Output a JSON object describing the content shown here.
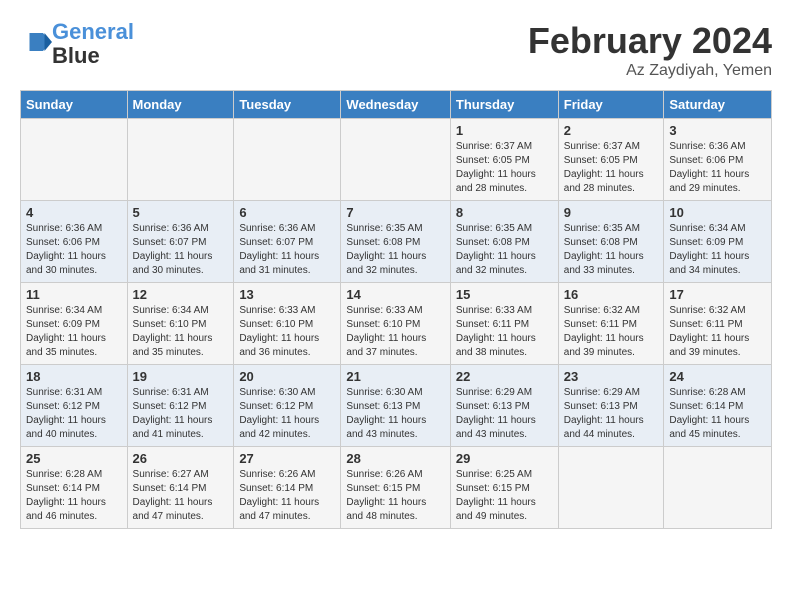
{
  "logo": {
    "line1": "General",
    "line2": "Blue"
  },
  "title": "February 2024",
  "location": "Az Zaydiyah, Yemen",
  "days_of_week": [
    "Sunday",
    "Monday",
    "Tuesday",
    "Wednesday",
    "Thursday",
    "Friday",
    "Saturday"
  ],
  "weeks": [
    [
      {
        "day": "",
        "info": ""
      },
      {
        "day": "",
        "info": ""
      },
      {
        "day": "",
        "info": ""
      },
      {
        "day": "",
        "info": ""
      },
      {
        "day": "1",
        "info": "Sunrise: 6:37 AM\nSunset: 6:05 PM\nDaylight: 11 hours\nand 28 minutes."
      },
      {
        "day": "2",
        "info": "Sunrise: 6:37 AM\nSunset: 6:05 PM\nDaylight: 11 hours\nand 28 minutes."
      },
      {
        "day": "3",
        "info": "Sunrise: 6:36 AM\nSunset: 6:06 PM\nDaylight: 11 hours\nand 29 minutes."
      }
    ],
    [
      {
        "day": "4",
        "info": "Sunrise: 6:36 AM\nSunset: 6:06 PM\nDaylight: 11 hours\nand 30 minutes."
      },
      {
        "day": "5",
        "info": "Sunrise: 6:36 AM\nSunset: 6:07 PM\nDaylight: 11 hours\nand 30 minutes."
      },
      {
        "day": "6",
        "info": "Sunrise: 6:36 AM\nSunset: 6:07 PM\nDaylight: 11 hours\nand 31 minutes."
      },
      {
        "day": "7",
        "info": "Sunrise: 6:35 AM\nSunset: 6:08 PM\nDaylight: 11 hours\nand 32 minutes."
      },
      {
        "day": "8",
        "info": "Sunrise: 6:35 AM\nSunset: 6:08 PM\nDaylight: 11 hours\nand 32 minutes."
      },
      {
        "day": "9",
        "info": "Sunrise: 6:35 AM\nSunset: 6:08 PM\nDaylight: 11 hours\nand 33 minutes."
      },
      {
        "day": "10",
        "info": "Sunrise: 6:34 AM\nSunset: 6:09 PM\nDaylight: 11 hours\nand 34 minutes."
      }
    ],
    [
      {
        "day": "11",
        "info": "Sunrise: 6:34 AM\nSunset: 6:09 PM\nDaylight: 11 hours\nand 35 minutes."
      },
      {
        "day": "12",
        "info": "Sunrise: 6:34 AM\nSunset: 6:10 PM\nDaylight: 11 hours\nand 35 minutes."
      },
      {
        "day": "13",
        "info": "Sunrise: 6:33 AM\nSunset: 6:10 PM\nDaylight: 11 hours\nand 36 minutes."
      },
      {
        "day": "14",
        "info": "Sunrise: 6:33 AM\nSunset: 6:10 PM\nDaylight: 11 hours\nand 37 minutes."
      },
      {
        "day": "15",
        "info": "Sunrise: 6:33 AM\nSunset: 6:11 PM\nDaylight: 11 hours\nand 38 minutes."
      },
      {
        "day": "16",
        "info": "Sunrise: 6:32 AM\nSunset: 6:11 PM\nDaylight: 11 hours\nand 39 minutes."
      },
      {
        "day": "17",
        "info": "Sunrise: 6:32 AM\nSunset: 6:11 PM\nDaylight: 11 hours\nand 39 minutes."
      }
    ],
    [
      {
        "day": "18",
        "info": "Sunrise: 6:31 AM\nSunset: 6:12 PM\nDaylight: 11 hours\nand 40 minutes."
      },
      {
        "day": "19",
        "info": "Sunrise: 6:31 AM\nSunset: 6:12 PM\nDaylight: 11 hours\nand 41 minutes."
      },
      {
        "day": "20",
        "info": "Sunrise: 6:30 AM\nSunset: 6:12 PM\nDaylight: 11 hours\nand 42 minutes."
      },
      {
        "day": "21",
        "info": "Sunrise: 6:30 AM\nSunset: 6:13 PM\nDaylight: 11 hours\nand 43 minutes."
      },
      {
        "day": "22",
        "info": "Sunrise: 6:29 AM\nSunset: 6:13 PM\nDaylight: 11 hours\nand 43 minutes."
      },
      {
        "day": "23",
        "info": "Sunrise: 6:29 AM\nSunset: 6:13 PM\nDaylight: 11 hours\nand 44 minutes."
      },
      {
        "day": "24",
        "info": "Sunrise: 6:28 AM\nSunset: 6:14 PM\nDaylight: 11 hours\nand 45 minutes."
      }
    ],
    [
      {
        "day": "25",
        "info": "Sunrise: 6:28 AM\nSunset: 6:14 PM\nDaylight: 11 hours\nand 46 minutes."
      },
      {
        "day": "26",
        "info": "Sunrise: 6:27 AM\nSunset: 6:14 PM\nDaylight: 11 hours\nand 47 minutes."
      },
      {
        "day": "27",
        "info": "Sunrise: 6:26 AM\nSunset: 6:14 PM\nDaylight: 11 hours\nand 47 minutes."
      },
      {
        "day": "28",
        "info": "Sunrise: 6:26 AM\nSunset: 6:15 PM\nDaylight: 11 hours\nand 48 minutes."
      },
      {
        "day": "29",
        "info": "Sunrise: 6:25 AM\nSunset: 6:15 PM\nDaylight: 11 hours\nand 49 minutes."
      },
      {
        "day": "",
        "info": ""
      },
      {
        "day": "",
        "info": ""
      }
    ]
  ]
}
